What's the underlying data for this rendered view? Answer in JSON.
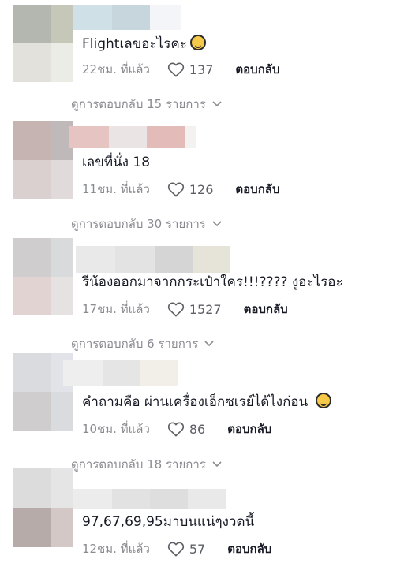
{
  "comments": [
    {
      "text": "Flightเลขอะไรคะ",
      "time": "22ชม. ที่แล้ว",
      "likes": "137",
      "reply": "ตอบกลับ",
      "view_replies": "ดูการตอบกลับ 15 รายการ",
      "emoji": "laughing-emoji-icon"
    },
    {
      "text": "เลขที่นั่ง 18",
      "time": "11ชม. ที่แล้ว",
      "likes": "126",
      "reply": "ตอบกลับ",
      "view_replies": "ดูการตอบกลับ 30 รายการ"
    },
    {
      "text": "รีน้องออกมาจากกระเป๋าใคร!!!???? งูอะไรอะ",
      "time": "17ชม. ที่แล้ว",
      "likes": "1527",
      "reply": "ตอบกลับ",
      "view_replies": "ดูการตอบกลับ 6 รายการ"
    },
    {
      "text": "คำถามคือ ผ่านเครื่องเอ็กซเรย์ได้ไงก่อน",
      "time": "10ชม. ที่แล้ว",
      "likes": "86",
      "reply": "ตอบกลับ",
      "view_replies": "ดูการตอบกลับ 18 รายการ",
      "emoji": "grimace-emoji-icon"
    },
    {
      "text": "97,67,69,95มาบนแน่ๆงวดนี้",
      "time": "12ชม. ที่แล้ว",
      "likes": "57",
      "reply": "ตอบกลับ"
    }
  ],
  "colors": {
    "muted": "#8a8b91",
    "text": "#161823"
  }
}
